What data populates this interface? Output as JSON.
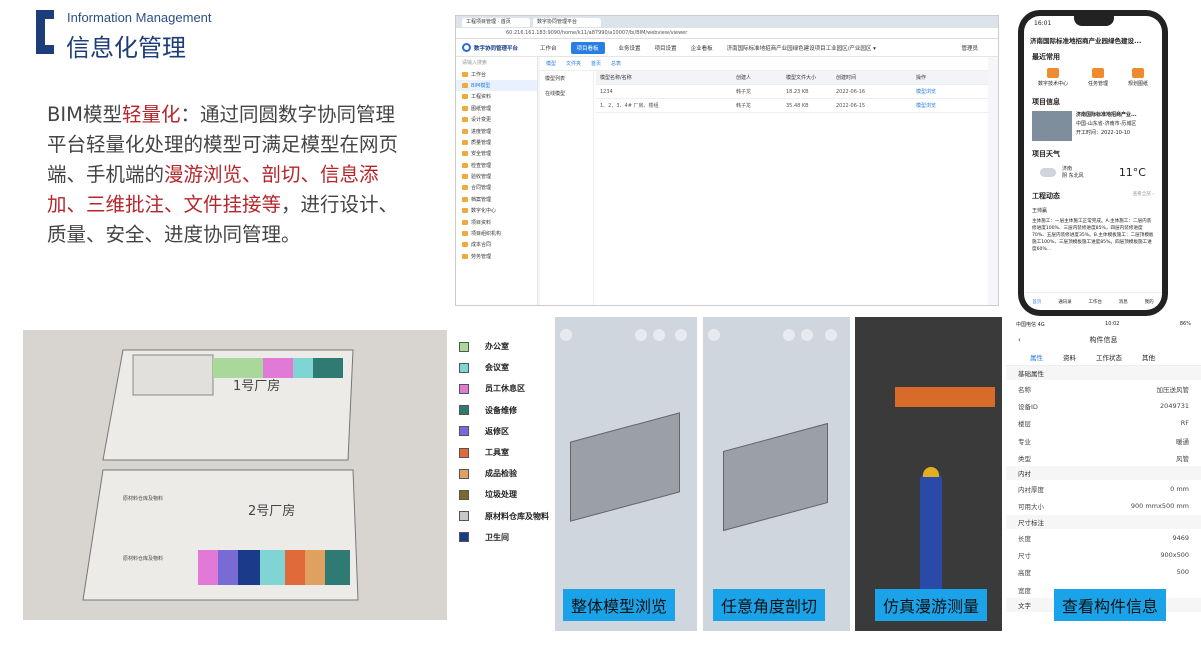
{
  "header": {
    "en": "Information Management",
    "cn": "信息化管理"
  },
  "paragraph": {
    "p1": "BIM模型",
    "p2": "轻量化",
    "p3": "：通过同圆数字协同管理平台轻量化处理的模型可满足模型在网页端、手机端的",
    "p4": "漫游浏览、剖切、信息添加、三维批注、文件挂接等",
    "p5": "，进行设计、质量、安全、进度协同管理。"
  },
  "browser": {
    "tabs": [
      "工程项目管理 · 首页",
      "数字协同管理平台"
    ],
    "url": "60.216.161.183:9090/home/k11/a87990/a10007/bi/BIM/webview/viewer",
    "logo": "数字协同管理平台",
    "nav": [
      "工作台",
      "项目看板",
      "业务设置",
      "项目设置",
      "企业看板"
    ],
    "nav_active": 1,
    "project": "济南国际标准地招商产业园绿色建设项目工业园区/产业园区 ▾",
    "user": "管理员",
    "sidebar_search": "请输入搜索",
    "sidebar": [
      "工作台",
      "BIM模型",
      "工程资料",
      "图纸管理",
      "设计变更",
      "进度管理",
      "质量管理",
      "安全管理",
      "检查管理",
      "验收管理",
      "合同管理",
      "档案管理",
      "数字化中心",
      "项目资料",
      "项目组织机构",
      "成本合同",
      "劳务管理"
    ],
    "sidebar_active": 1,
    "crumbs": [
      "模型",
      "文件夹",
      "首页",
      "总表"
    ],
    "tree": [
      "模型列表",
      "在线模型"
    ],
    "table_head": [
      "模型名称/名称",
      "创建人",
      "模型文件大小",
      "创建时间",
      "操作"
    ],
    "rows": [
      [
        "1234",
        "韩子龙",
        "18.23 KB",
        "2022-06-16",
        "模型浏览"
      ],
      [
        "1、2、3、4# 厂房、楼组",
        "韩子龙",
        "35.48 KB",
        "2022-06-15",
        "模型浏览"
      ]
    ]
  },
  "phone": {
    "time": "16:01",
    "title": "济南国际标准地招商产业园绿色建设...",
    "recent": "最近常用",
    "apps": [
      "数字技术中心",
      "任务管理",
      "规划图纸"
    ],
    "info": "项目信息",
    "proj": "济南国际标准地招商产业...",
    "loc": "中国-山东省-济南市-历城区",
    "start": "开工时间：2022-10-10",
    "weather": "项目天气",
    "city": "济南",
    "wdesc": "阴 东北风",
    "temp": "11°C",
    "news": "工程动态",
    "more": "查看全部 ›",
    "user": "王帅赢",
    "body": "主体施工：一层主体施工正常完成。A.主体施工：二层内装修进度100%、三层内装修进度85%，四层内装修进度70%、五层内装修进度35%。B.主体模板施工：二层顶模板施工100%、三层顶模板施工进度85%。四层顶模板施工进度60%...",
    "tabs": [
      "首页",
      "通讯录",
      "工作台",
      "消息",
      "我的"
    ]
  },
  "plan": {
    "room1": "1号厂房",
    "room2": "2号厂房",
    "room3": "原材料仓库及物料",
    "room4": "原材料仓库及物料"
  },
  "legend": [
    {
      "label": "办公室",
      "color": "#a8d89a"
    },
    {
      "label": "会议室",
      "color": "#7fd4d4"
    },
    {
      "label": "员工休息区",
      "color": "#e07ad6"
    },
    {
      "label": "设备维修",
      "color": "#2f7a72"
    },
    {
      "label": "返修区",
      "color": "#7a6ad6"
    },
    {
      "label": "工具室",
      "color": "#e06a3a"
    },
    {
      "label": "成品检验",
      "color": "#e0a060"
    },
    {
      "label": "垃圾处理",
      "color": "#7a6a2a"
    },
    {
      "label": "原材料仓库及物料",
      "color": "#c8c8c8"
    },
    {
      "label": "卫生间",
      "color": "#1a3a8a"
    }
  ],
  "captions": [
    "整体模型浏览",
    "任意角度剖切",
    "仿真漫游测量",
    "查看构件信息"
  ],
  "props": {
    "status": "中国电信 4G",
    "time": "10:02",
    "battery": "86%",
    "title": "构件信息",
    "tabs": [
      "属性",
      "资料",
      "工作状态",
      "其他"
    ],
    "g1": "基础属性",
    "rows1": [
      [
        "名称",
        "加压送风管"
      ],
      [
        "设备ID",
        "2049731"
      ],
      [
        "楼层",
        "RF"
      ],
      [
        "专业",
        "暖通"
      ],
      [
        "类型",
        "风管"
      ]
    ],
    "g2": "内衬",
    "rows2": [
      [
        "内衬厚度",
        "0 mm"
      ],
      [
        "可用大小",
        "900 mmx500 mm"
      ]
    ],
    "g3": "尺寸标注",
    "rows3": [
      [
        "长度",
        "9469"
      ],
      [
        "尺寸",
        "900x500"
      ],
      [
        "高度",
        "500"
      ],
      [
        "宽度",
        ""
      ]
    ],
    "g4": "文字"
  }
}
